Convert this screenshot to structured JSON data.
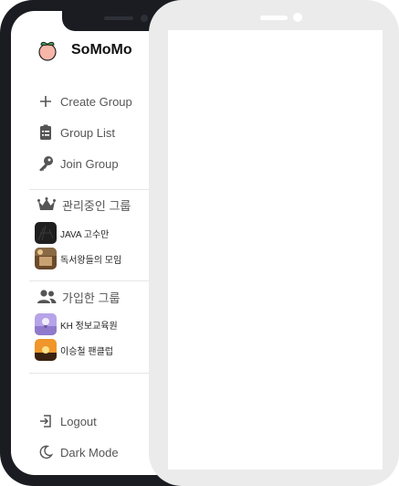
{
  "app": {
    "name": "SoMoMo",
    "logo": "peach-logo-icon"
  },
  "nav": [
    {
      "label": "Create Group",
      "icon": "plus-icon"
    },
    {
      "label": "Group List",
      "icon": "clipboard-icon"
    },
    {
      "label": "Join Group",
      "icon": "key-icon"
    }
  ],
  "managed": {
    "title": "관리중인 그룹",
    "icon": "crown-icon",
    "groups": [
      {
        "name": "JAVA 고수만"
      },
      {
        "name": "독서왕들의 모임"
      }
    ]
  },
  "joined": {
    "title": "가입한 그룹",
    "icon": "users-icon",
    "groups": [
      {
        "name": "KH 정보교육원"
      },
      {
        "name": "이승철 팬클럽"
      }
    ]
  },
  "footer": {
    "logout": "Logout",
    "dark_mode": "Dark Mode"
  },
  "colors": {
    "accent": "#555555",
    "frame_dark": "#1a1c22",
    "frame_light": "#ebebeb"
  }
}
